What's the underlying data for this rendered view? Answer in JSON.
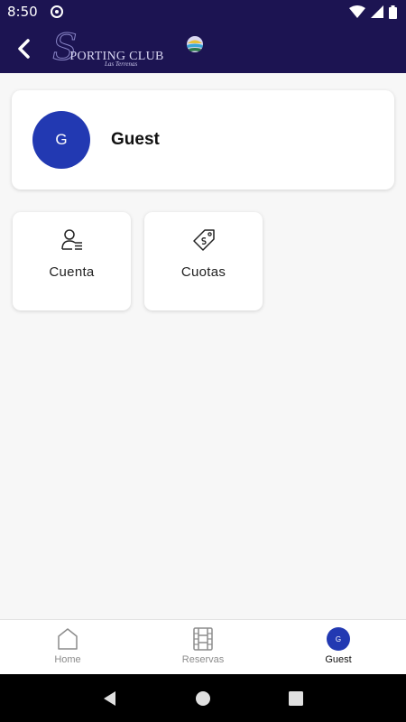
{
  "status_bar": {
    "time": "8:50"
  },
  "app_bar": {
    "logo_initial": "S",
    "logo_text": "PORTING CLUB",
    "logo_subtitle": "Las Terrenas"
  },
  "profile": {
    "initial": "G",
    "name": "Guest"
  },
  "tiles": [
    {
      "label": "Cuenta",
      "icon": "user-list-icon"
    },
    {
      "label": "Cuotas",
      "icon": "price-tag-icon"
    }
  ],
  "bottom_nav": {
    "items": [
      {
        "label": "Home",
        "icon": "home-icon",
        "active": false
      },
      {
        "label": "Reservas",
        "icon": "film-icon",
        "active": false
      },
      {
        "label": "Guest",
        "icon": "avatar",
        "active": true,
        "initial": "G"
      }
    ]
  },
  "colors": {
    "primary_dark": "#1c1452",
    "avatar_blue": "#2239b2",
    "background": "#f7f7f7"
  }
}
